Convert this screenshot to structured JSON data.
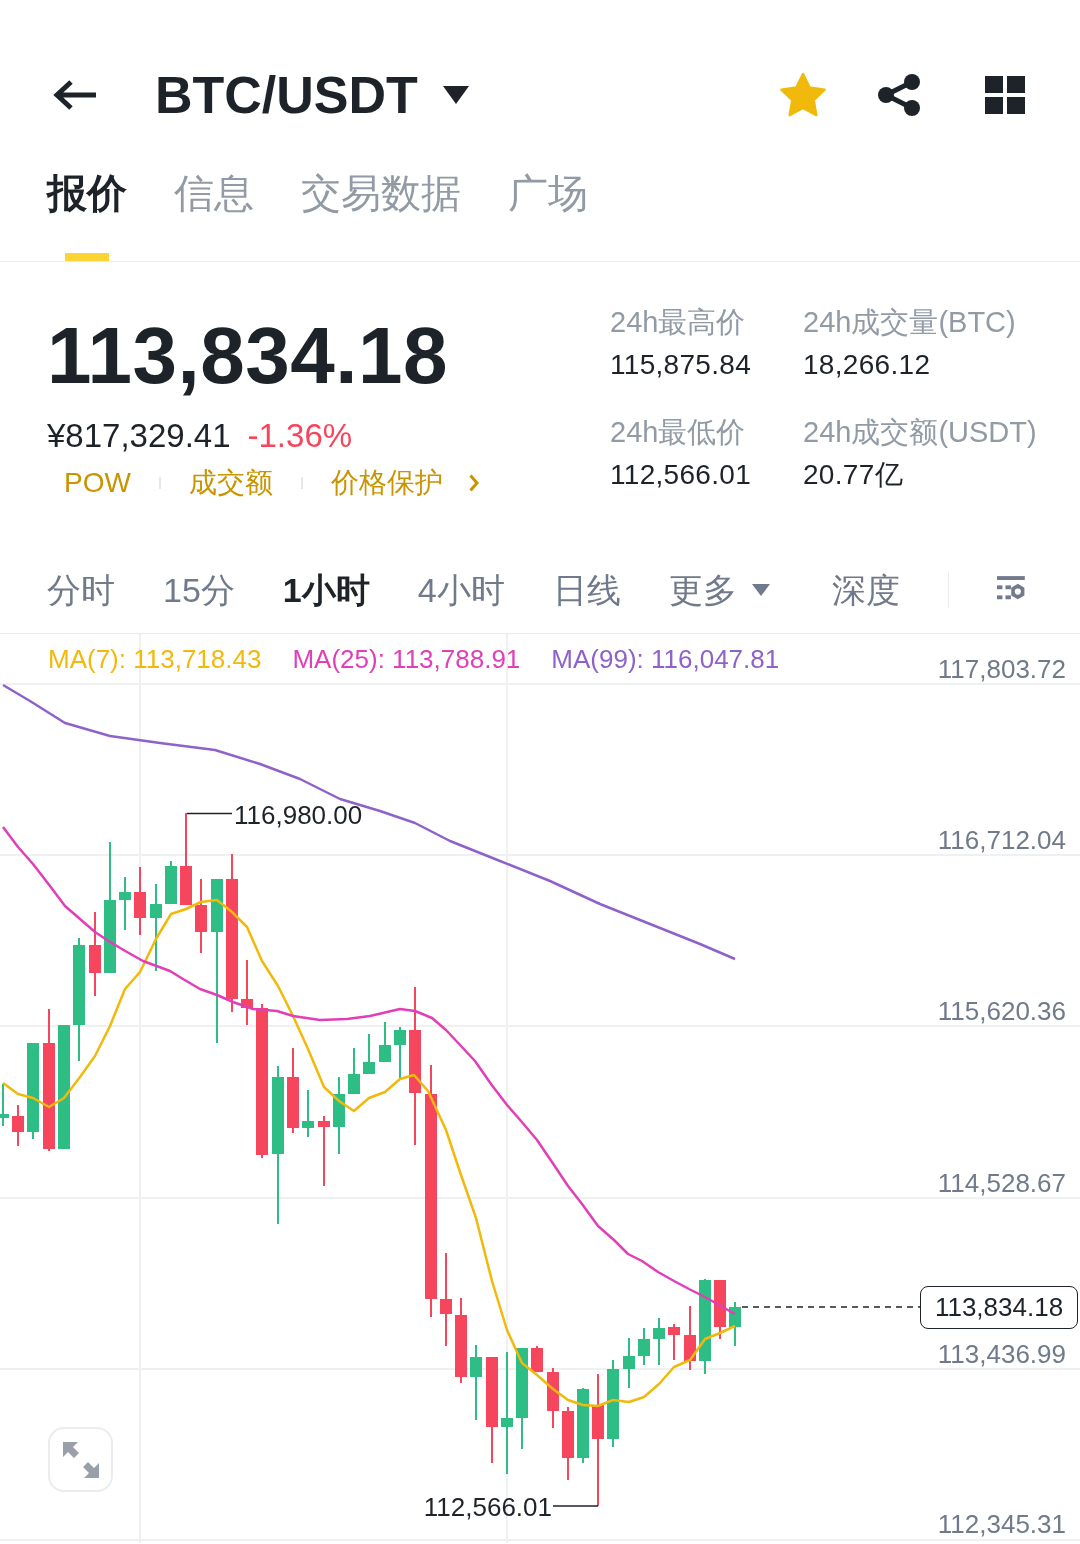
{
  "header": {
    "title": "BTC/USDT",
    "favorited": true
  },
  "tabs": [
    {
      "label": "报价",
      "selected": true
    },
    {
      "label": "信息",
      "selected": false
    },
    {
      "label": "交易数据",
      "selected": false
    },
    {
      "label": "广场",
      "selected": false
    }
  ],
  "ticker": {
    "last_price": "113,834.18",
    "fiat_price": "¥817,329.41",
    "change": "-1.36%",
    "tags": [
      {
        "label": "POW",
        "kind": "tag"
      },
      {
        "label": "成交额",
        "kind": "tag"
      },
      {
        "label": "价格保护",
        "kind": "link"
      }
    ]
  },
  "stats": [
    {
      "label": "24h最高价",
      "value": "115,875.84"
    },
    {
      "label": "24h成交量(BTC)",
      "value": "18,266.12"
    },
    {
      "label": "24h最低价",
      "value": "112,566.01"
    },
    {
      "label": "24h成交额(USDT)",
      "value": "20.77亿"
    }
  ],
  "intervals": [
    {
      "label": "分时",
      "selected": false,
      "kind": "interval"
    },
    {
      "label": "15分",
      "selected": false,
      "kind": "interval"
    },
    {
      "label": "1小时",
      "selected": true,
      "kind": "interval"
    },
    {
      "label": "4小时",
      "selected": false,
      "kind": "interval"
    },
    {
      "label": "日线",
      "selected": false,
      "kind": "interval"
    },
    {
      "label": "更多",
      "selected": false,
      "kind": "menu"
    },
    {
      "label": "深度",
      "selected": false,
      "kind": "view"
    }
  ],
  "chart": {
    "moving_averages": [
      {
        "label": "MA(7): 113,718.43",
        "color": "#f0b90b"
      },
      {
        "label": "MA(25): 113,788.91",
        "color": "#e13fb8"
      },
      {
        "label": "MA(99): 116,047.81",
        "color": "#8e62c8"
      }
    ],
    "y_axis_labels": [
      "117,803.72",
      "116,712.04",
      "115,620.36",
      "114,528.67",
      "113,436.99",
      "112,345.31"
    ],
    "high_label": "116,980.00",
    "low_label": "112,566.01",
    "last_price_label": "113,834.18"
  }
}
